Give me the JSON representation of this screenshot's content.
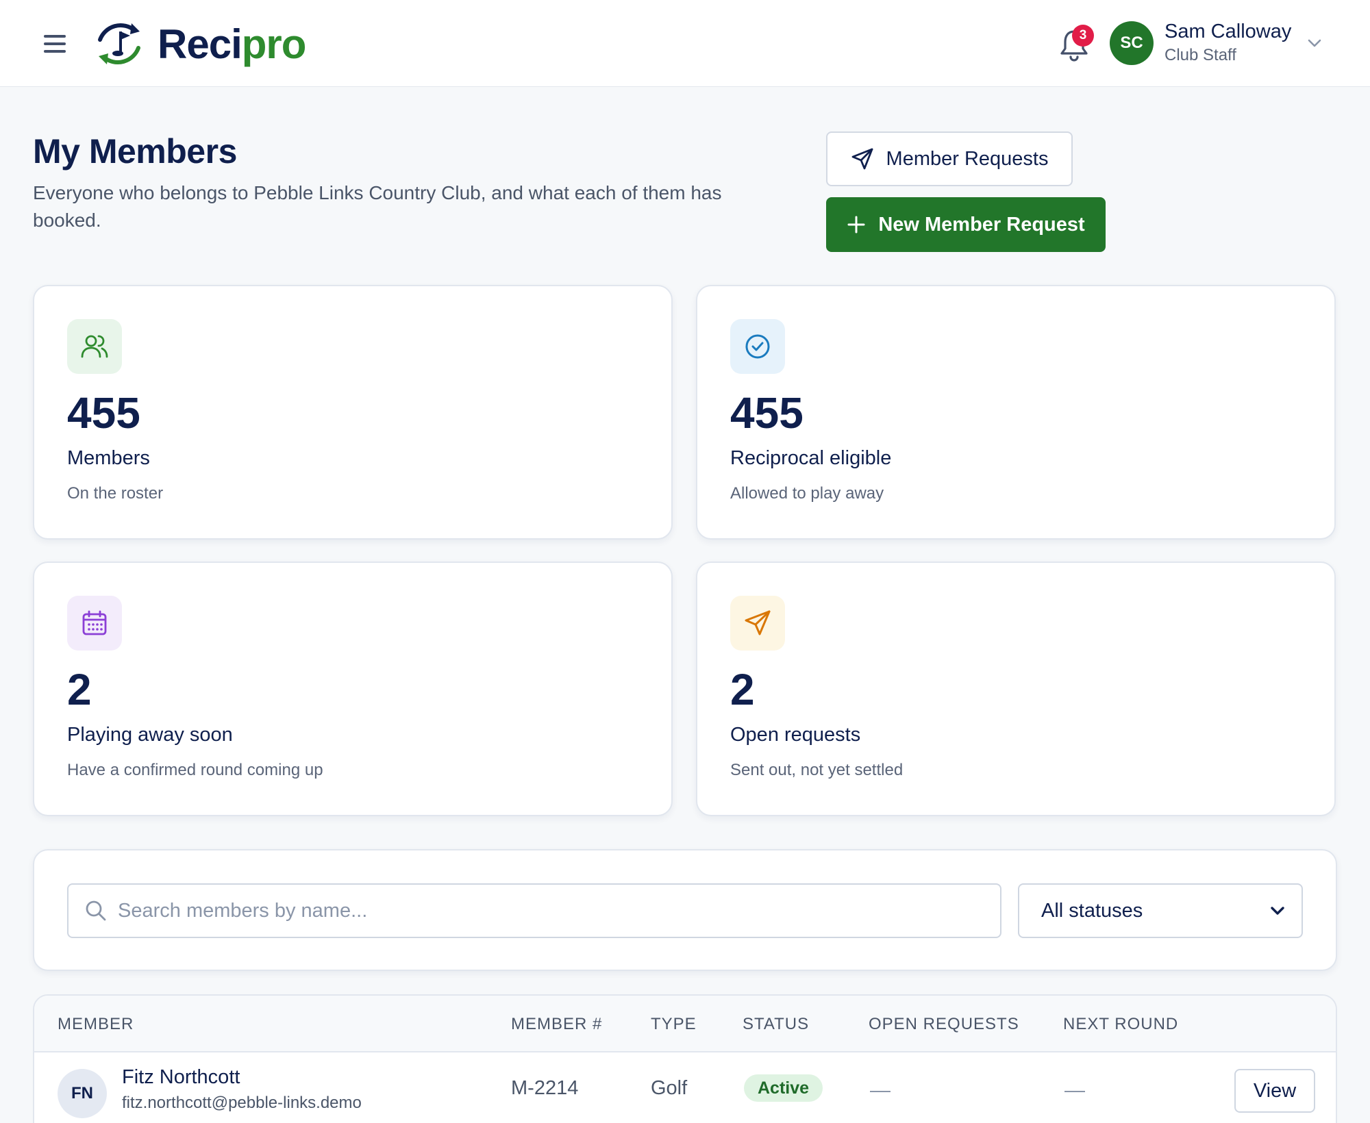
{
  "app": {
    "brand_part1": "Reci",
    "brand_part2": "pro",
    "brand_colors": {
      "navy": "#0f1f4d",
      "green": "#2e8b2e"
    }
  },
  "header": {
    "notifications_count": "3",
    "user": {
      "initials": "SC",
      "name": "Sam Calloway",
      "role": "Club Staff"
    }
  },
  "page": {
    "title": "My Members",
    "subtitle": "Everyone who belongs to Pebble Links Country Club, and what each of them has booked."
  },
  "actions": {
    "member_requests_label": "Member Requests",
    "new_member_request_label": "New Member Request",
    "primary_color": "#22762a"
  },
  "stats": [
    {
      "icon": "users-icon",
      "value": "455",
      "label": "Members",
      "desc": "On the roster",
      "tile_color": "#e8f5ea",
      "icon_color": "#2e8b2e"
    },
    {
      "icon": "check-circle-icon",
      "value": "455",
      "label": "Reciprocal eligible",
      "desc": "Allowed to play away",
      "tile_color": "#e6f2fb",
      "icon_color": "#1a7bbf"
    },
    {
      "icon": "calendar-icon",
      "value": "2",
      "label": "Playing away soon",
      "desc": "Have a confirmed round coming up",
      "tile_color": "#f3ecfb",
      "icon_color": "#8b3fd6"
    },
    {
      "icon": "send-icon",
      "value": "2",
      "label": "Open requests",
      "desc": "Sent out, not yet settled",
      "tile_color": "#fdf6e3",
      "icon_color": "#d97706"
    }
  ],
  "filters": {
    "search_placeholder": "Search members by name...",
    "status_selected": "All statuses"
  },
  "table": {
    "columns": [
      "MEMBER",
      "MEMBER #",
      "TYPE",
      "STATUS",
      "OPEN REQUESTS",
      "NEXT ROUND"
    ],
    "rows": [
      {
        "initials": "FN",
        "name": "Fitz Northcott",
        "email": "fitz.northcott@pebble-links.demo",
        "member_number": "M-2214",
        "type": "Golf",
        "status": "Active",
        "open_requests": "—",
        "next_round": "—",
        "action_label": "View"
      }
    ]
  }
}
